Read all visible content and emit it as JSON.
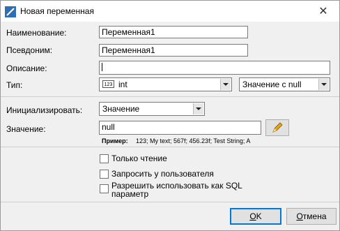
{
  "window": {
    "title": "Новая переменная",
    "close_glyph": "✕"
  },
  "fields": {
    "name_label": "Наименование:",
    "name_value": "Переменная1",
    "alias_label": "Псевдоним:",
    "alias_value": "Переменная1",
    "description_label": "Описание:",
    "description_value": "",
    "type_label": "Тип:",
    "type_badge": "123",
    "type_value": "int",
    "nullability_value": "Значение с null",
    "init_label": "Инициализировать:",
    "init_value": "Значение",
    "value_label": "Значение:",
    "value_value": "null",
    "example_label": "Пример:",
    "example_text": "123; My text; 567f; 456.23f; Test String; A"
  },
  "options": {
    "readonly": "Только чтение",
    "ask_user": "Запросить у пользователя",
    "sql_param_line1": "Разрешить использовать как SQL",
    "sql_param_line2": "параметр"
  },
  "buttons": {
    "ok": {
      "mnemonic": "O",
      "rest": "K"
    },
    "cancel": {
      "mnemonic": "О",
      "rest": "тмена"
    }
  },
  "colors": {
    "accent": "#0078d7",
    "edit_pencil": "#e8a317"
  }
}
